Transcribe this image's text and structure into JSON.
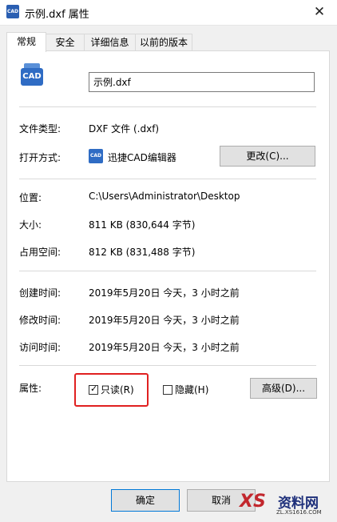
{
  "window": {
    "title": "示例.dxf 属性",
    "close_glyph": "✕"
  },
  "tabs": [
    {
      "label": "常规"
    },
    {
      "label": "安全"
    },
    {
      "label": "详细信息"
    },
    {
      "label": "以前的版本"
    }
  ],
  "general": {
    "icon_text": "CAD",
    "file_name": "示例.dxf",
    "file_type_label": "文件类型:",
    "file_type_value": "DXF 文件 (.dxf)",
    "open_with_label": "打开方式:",
    "open_with_app": "迅捷CAD编辑器",
    "app_icon_text": "CAD",
    "change_button": "更改(C)...",
    "location_label": "位置:",
    "location_value": "C:\\Users\\Administrator\\Desktop",
    "size_label": "大小:",
    "size_value": "811 KB (830,644 字节)",
    "disk_size_label": "占用空间:",
    "disk_size_value": "812 KB (831,488 字节)",
    "created_label": "创建时间:",
    "created_value": "2019年5月20日 今天，3 小时之前",
    "modified_label": "修改时间:",
    "modified_value": "2019年5月20日 今天，3 小时之前",
    "accessed_label": "访问时间:",
    "accessed_value": "2019年5月20日 今天，3 小时之前",
    "attributes_label": "属性:",
    "readonly_label": "只读(R)",
    "readonly_checked": true,
    "hidden_label": "隐藏(H)",
    "hidden_checked": false,
    "advanced_button": "高级(D)..."
  },
  "footer": {
    "ok": "确定",
    "cancel": "取消"
  },
  "watermark": {
    "mark": "XS",
    "name": "资料网",
    "url": "ZL.XS1616.COM"
  },
  "colors": {
    "highlight_border": "#e02020",
    "app_icon": "#2f6cc4"
  }
}
